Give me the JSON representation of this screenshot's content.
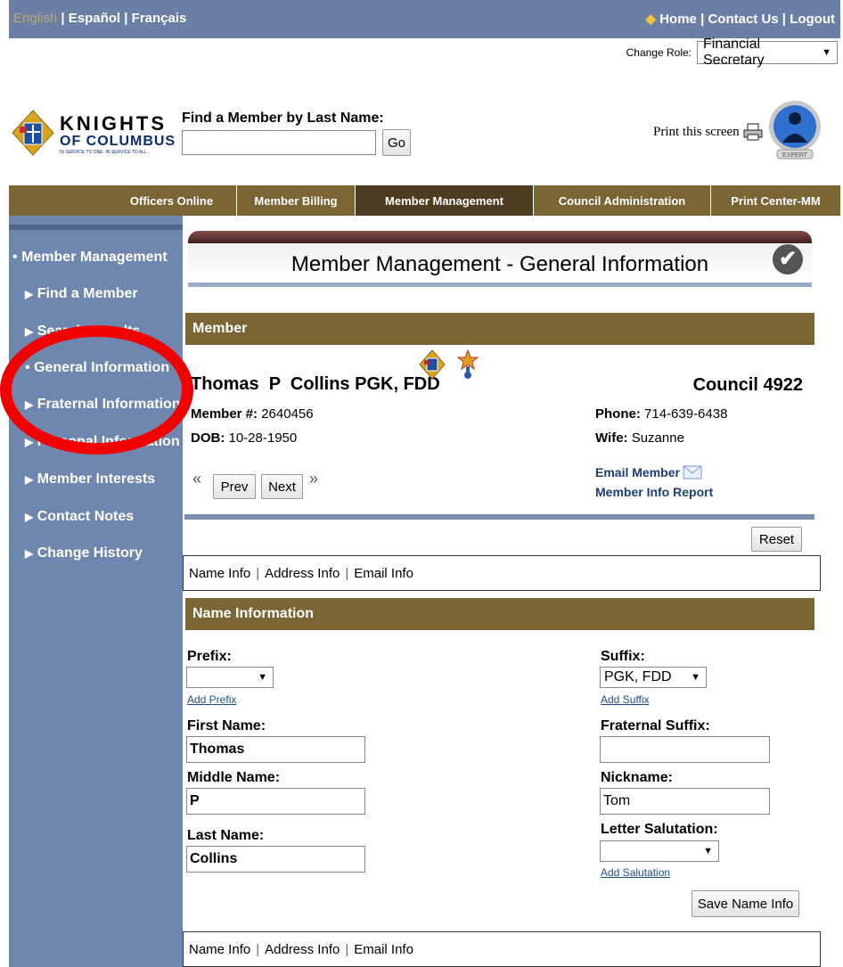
{
  "topbar": {
    "languages": [
      "English",
      "Español",
      "Français"
    ],
    "links": [
      "Home",
      "Contact Us",
      "Logout"
    ]
  },
  "role": {
    "label": "Change Role:",
    "value": "Financial Secretary"
  },
  "header": {
    "logo_line1": "KNIGHTS",
    "logo_line2": "OF COLUMBUS",
    "logo_tagline": "IN SERVICE TO ONE. IN SERVICE TO ALL.",
    "find_label": "Find a Member by Last Name:",
    "find_value": "",
    "go_label": "Go",
    "print_label": "Print this screen",
    "expert_badge": "EXPERT"
  },
  "nav": [
    "Officers Online",
    "Member Billing",
    "Member Management",
    "Council Administration",
    "Print Center-MM"
  ],
  "sidebar": {
    "items": [
      {
        "label": "Member Management",
        "marker": "•"
      },
      {
        "label": "Find a Member",
        "marker": "▶"
      },
      {
        "label": "Search Results",
        "marker": "▶"
      },
      {
        "label": "General Information",
        "marker": "•"
      },
      {
        "label": "Fraternal Information",
        "marker": "▶"
      },
      {
        "label": "Personal Information",
        "marker": "▶"
      },
      {
        "label": "Member Interests",
        "marker": "▶"
      },
      {
        "label": "Contact Notes",
        "marker": "▶"
      },
      {
        "label": "Change History",
        "marker": "▶"
      }
    ]
  },
  "page": {
    "title": "Member Management - General Information"
  },
  "member": {
    "section_label": "Member",
    "name": "Thomas  P  Collins PGK, FDD",
    "council_label": "Council",
    "council_number": "4922",
    "member_no_label": "Member #:",
    "member_no": "2640456",
    "dob_label": "DOB:",
    "dob": "10-28-1950",
    "phone_label": "Phone:",
    "phone": "714-639-6438",
    "wife_label": "Wife:",
    "wife": "Suzanne",
    "email_link": "Email Member",
    "report_link": "Member Info Report",
    "prev_label": "Prev",
    "next_label": "Next",
    "first_arrow": "«",
    "last_arrow": "»"
  },
  "reset_label": "Reset",
  "tabs": [
    "Name Info",
    "Address Info",
    "Email Info"
  ],
  "name_info": {
    "section_label": "Name Information",
    "prefix_label": "Prefix:",
    "prefix_value": "",
    "add_prefix": "Add Prefix",
    "first_label": "First Name:",
    "first_value": "Thomas",
    "middle_label": "Middle Name:",
    "middle_value": "P",
    "last_label": "Last Name:",
    "last_value": "Collins",
    "suffix_label": "Suffix:",
    "suffix_value": "PGK, FDD",
    "add_suffix": "Add Suffix",
    "fraternal_suffix_label": "Fraternal Suffix:",
    "fraternal_suffix_value": "",
    "nickname_label": "Nickname:",
    "nickname_value": "Tom",
    "salutation_label": "Letter Salutation:",
    "salutation_value": "",
    "add_salutation": "Add Salutation",
    "save_label": "Save Name Info"
  },
  "colors": {
    "topbar": "#6b7ea5",
    "nav": "#7b6535",
    "nav_active": "#4e3c20",
    "sidebar": "#6f86ae",
    "highlight_circle": "#f20000"
  }
}
